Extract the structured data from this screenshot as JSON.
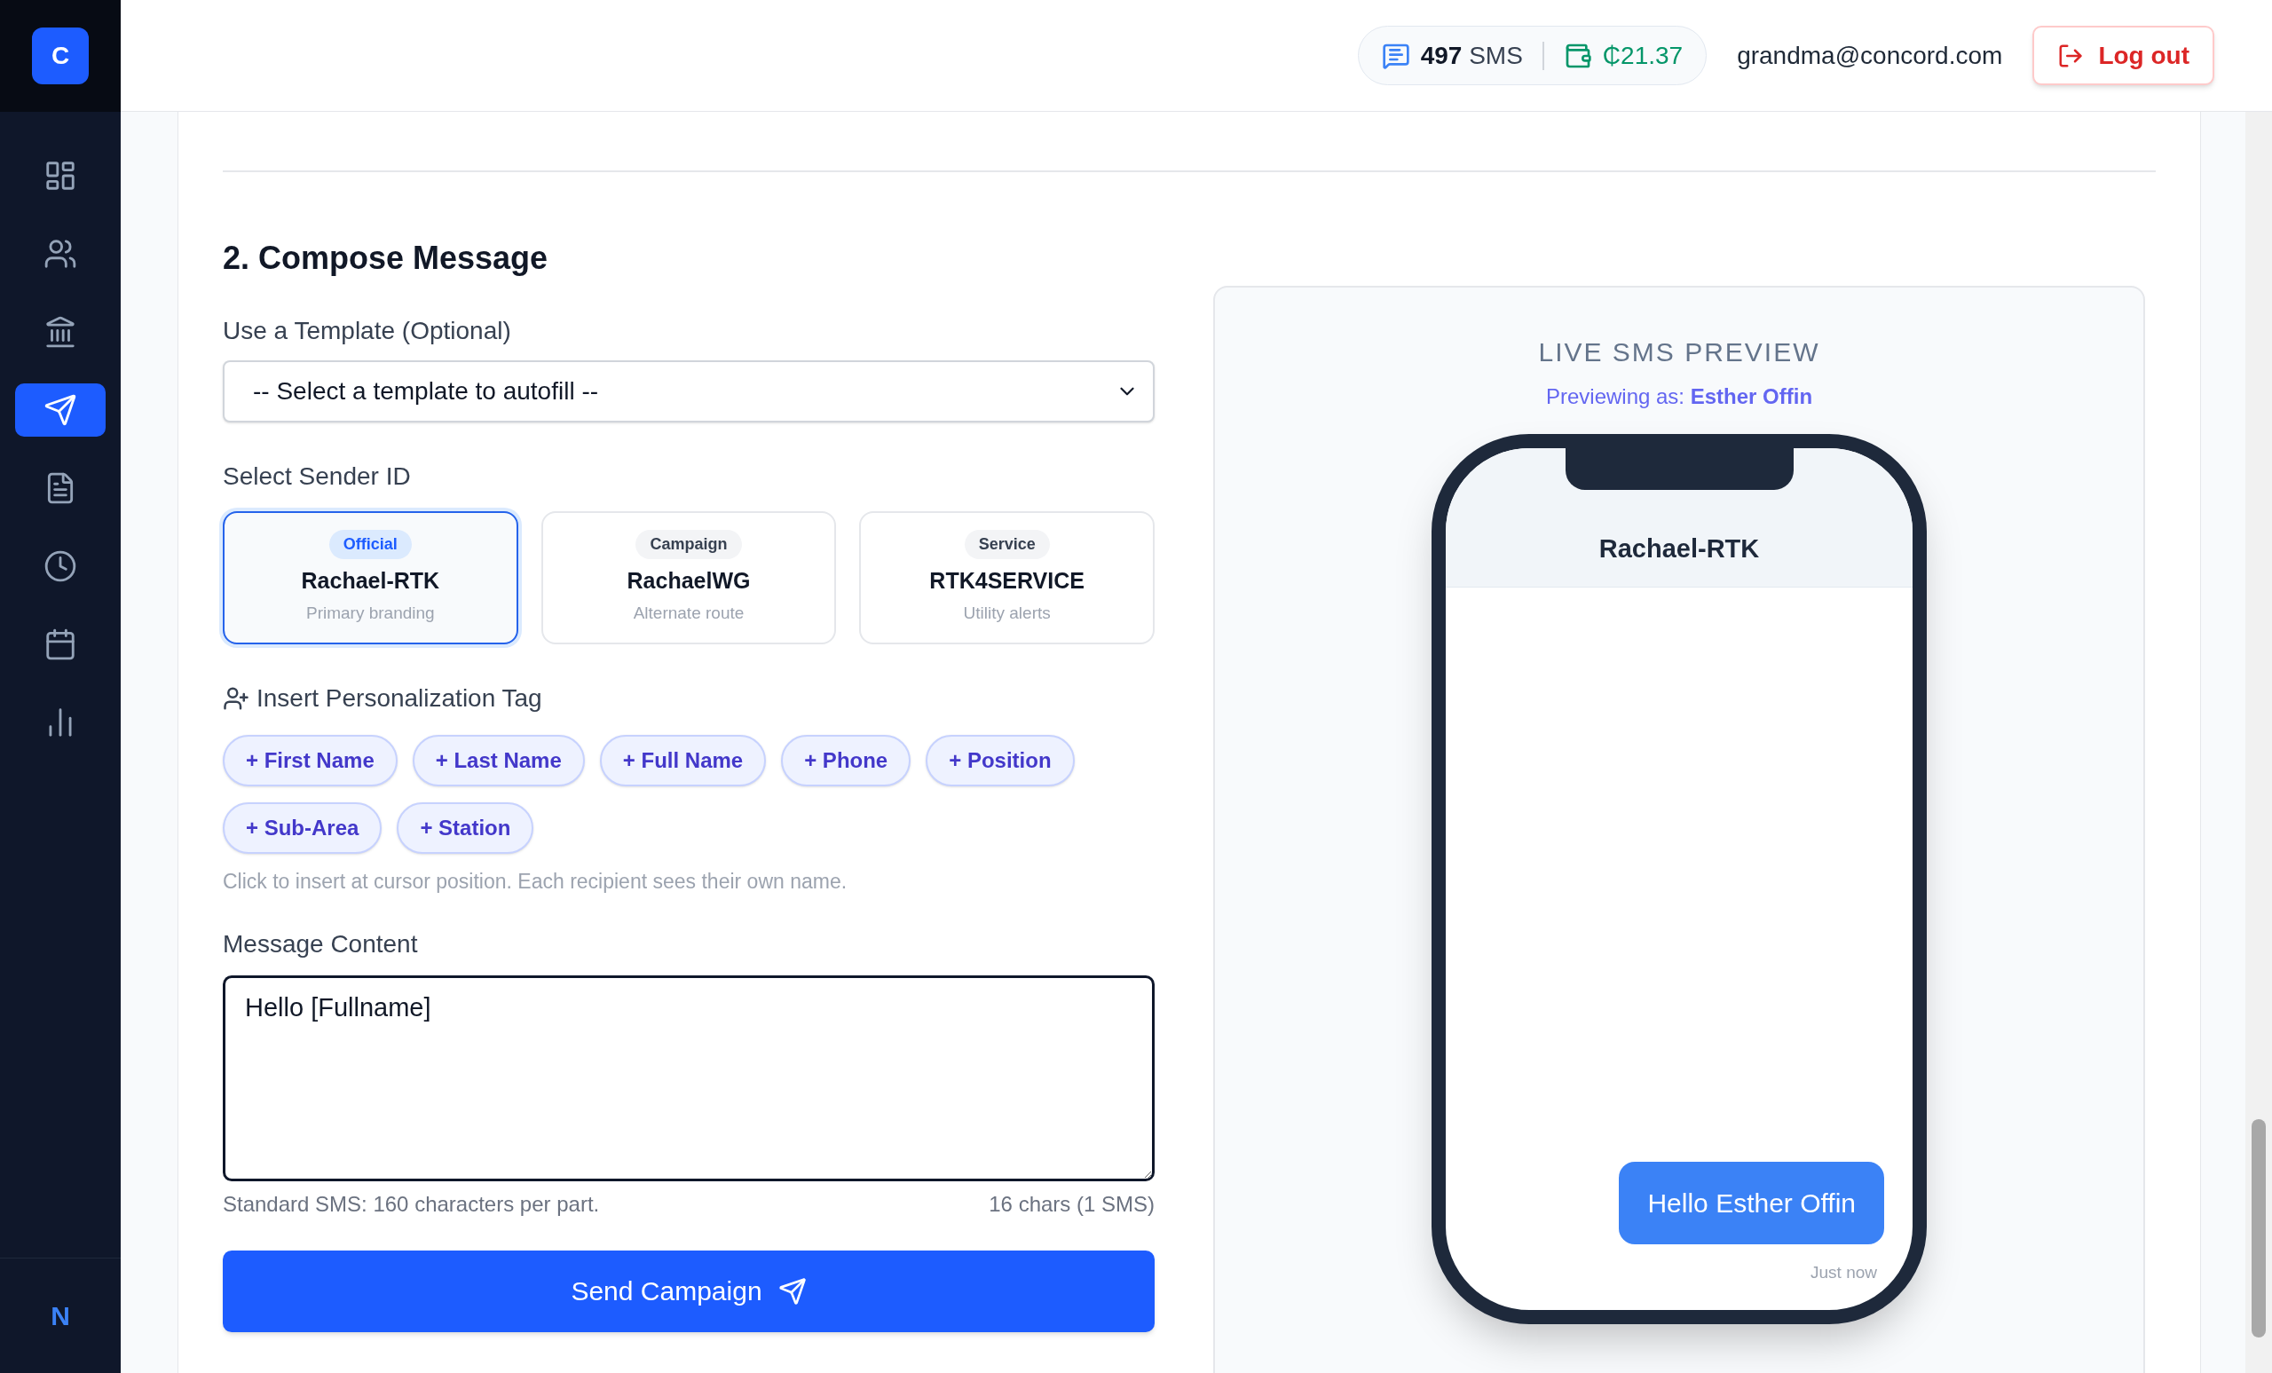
{
  "sidebar": {
    "logo": "C",
    "items": [
      {
        "kind": "dashboard",
        "selected": false
      },
      {
        "kind": "contacts",
        "selected": false
      },
      {
        "kind": "institutions",
        "selected": false
      },
      {
        "kind": "send",
        "selected": true
      },
      {
        "kind": "templates",
        "selected": false
      },
      {
        "kind": "history",
        "selected": false
      },
      {
        "kind": "calendar",
        "selected": false
      },
      {
        "kind": "reports",
        "selected": false
      }
    ],
    "footer": "N"
  },
  "header": {
    "sms_count": "497",
    "sms_label": "SMS",
    "balance": "₵21.37",
    "email": "grandma@concord.com",
    "logout": "Log out"
  },
  "compose": {
    "title": "2. Compose Message",
    "template": {
      "label": "Use a Template (Optional)",
      "value": "-- Select a template to autofill --"
    },
    "sender": {
      "label": "Select Sender ID",
      "options": [
        {
          "badge": "Official",
          "name": "Rachael-RTK",
          "description": "Primary branding",
          "selected": true
        },
        {
          "badge": "Campaign",
          "name": "RachaelWG",
          "description": "Alternate route",
          "selected": false
        },
        {
          "badge": "Service",
          "name": "RTK4SERVICE",
          "description": "Utility alerts",
          "selected": false
        }
      ]
    },
    "tags": {
      "label": "Insert Personalization Tag",
      "items": [
        "+ First Name",
        "+ Last Name",
        "+ Full Name",
        "+ Phone",
        "+ Position",
        "+ Sub-Area",
        "+ Station"
      ],
      "hint": "Click to insert at cursor position. Each recipient sees their own name."
    },
    "message": {
      "label": "Message Content",
      "value": "Hello [Fullname]",
      "footer_left": "Standard SMS: 160 characters per part.",
      "footer_right": "16 chars (1 SMS)"
    },
    "send_button": "Send Campaign"
  },
  "preview": {
    "title": "LIVE SMS PREVIEW",
    "previewing_label": "Previewing as:",
    "recipient": "Esther Offin",
    "sender_name": "Rachael-RTK",
    "bubble": "Hello Esther Offin",
    "time": "Just now"
  }
}
